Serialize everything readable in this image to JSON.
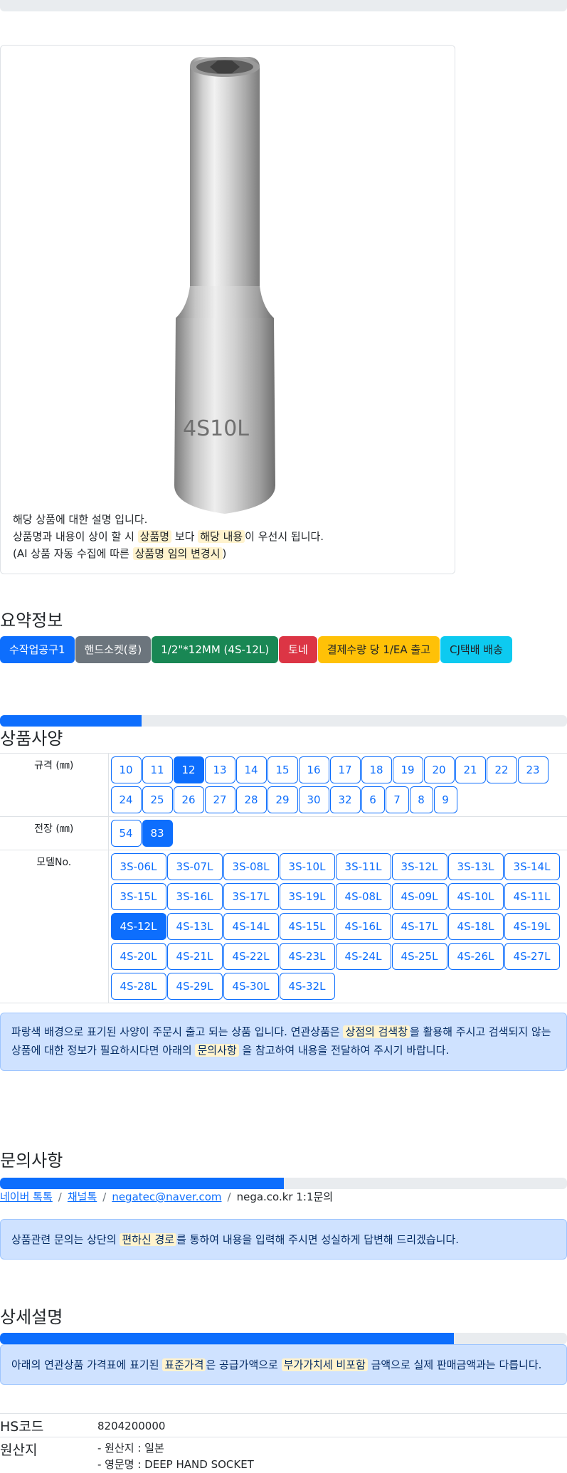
{
  "product": {
    "image_alt": "deep hand socket",
    "socket_engraving": "4S10L",
    "caption": {
      "line1": "해당 상품에 대한 설명 입니다.",
      "line2_pre": "상품명과 내용이 상이 할 시 ",
      "line2_hl1": "상품명",
      "line2_mid": " 보다 ",
      "line2_hl2": "해당 내용",
      "line2_post": "이 우선시 됩니다.",
      "line3_pre": "(AI 상품 자동 수집에 따른 ",
      "line3_hl": "상품명 임의 변경시",
      "line3_post": ")"
    }
  },
  "summary": {
    "title": "요약정보",
    "badges": [
      "수작업공구1",
      "핸드소켓(롱)",
      "1/2\"*12MM (4S-12L)",
      "토네",
      "결제수량 당 1/EA 출고",
      "CJ택배 배송"
    ]
  },
  "spec": {
    "title": "상품사양",
    "progress": 0.25,
    "size_label": "규격 (㎜)",
    "sizes": [
      "10",
      "11",
      "12",
      "13",
      "14",
      "15",
      "16",
      "17",
      "18",
      "19",
      "20",
      "21",
      "22",
      "23",
      "24",
      "25",
      "26",
      "27",
      "28",
      "29",
      "30",
      "32",
      "6",
      "7",
      "8",
      "9"
    ],
    "size_selected": "12",
    "length_label": "전장 (㎜)",
    "lengths": [
      "54",
      "83"
    ],
    "length_selected": "83",
    "model_label": "모델No.",
    "models": [
      "3S-06L",
      "3S-07L",
      "3S-08L",
      "3S-10L",
      "3S-11L",
      "3S-12L",
      "3S-13L",
      "3S-14L",
      "3S-15L",
      "3S-16L",
      "3S-17L",
      "3S-19L",
      "4S-08L",
      "4S-09L",
      "4S-10L",
      "4S-11L",
      "4S-12L",
      "4S-13L",
      "4S-14L",
      "4S-15L",
      "4S-16L",
      "4S-17L",
      "4S-18L",
      "4S-19L",
      "4S-20L",
      "4S-21L",
      "4S-22L",
      "4S-23L",
      "4S-24L",
      "4S-25L",
      "4S-26L",
      "4S-27L",
      "4S-28L",
      "4S-29L",
      "4S-30L",
      "4S-32L"
    ],
    "model_selected": "4S-12L",
    "notice": {
      "pre": "파랑색 배경으로 표기된 사양이 주문시 출고 되는 상품 입니다. 연관상품은 ",
      "hl1": "상점의 검색창",
      "mid": "을 활용해 주시고 검색되지 않는 상품에 대한 정보가 필요하시다면 아래의 ",
      "hl2": "문의사항",
      "post": " 을 참고하여 내용을 전달하여 주시기 바랍니다."
    }
  },
  "inquiry": {
    "title": "문의사항",
    "progress": 0.5,
    "links": [
      "네이버 톡톡",
      "채널톡",
      "negatec@naver.com"
    ],
    "plain": "nega.co.kr 1:1문의",
    "notice": {
      "pre": "상품관련 문의는 상단의 ",
      "hl": "편하신 경로",
      "post": "를 통하여 내용을 입력해 주시면 성실하게 답변해 드리겠습니다."
    }
  },
  "detail": {
    "title": "상세설명",
    "progress": 0.8,
    "notice": {
      "pre": "아래의 연관상품 가격표에 표기된 ",
      "hl1": "표준가격",
      "mid": "은 공급가액으로 ",
      "hl2": "부가가치세 비포함",
      "post": " 금액으로 실제 판매금액과는 다릅니다."
    },
    "hs_label": "HS코드",
    "hs_value": "8204200000",
    "origin_label": "원산지",
    "origin_line1": "- 원산지 : 일본",
    "origin_line2": "- 영문명 : DEEP HAND SOCKET"
  }
}
